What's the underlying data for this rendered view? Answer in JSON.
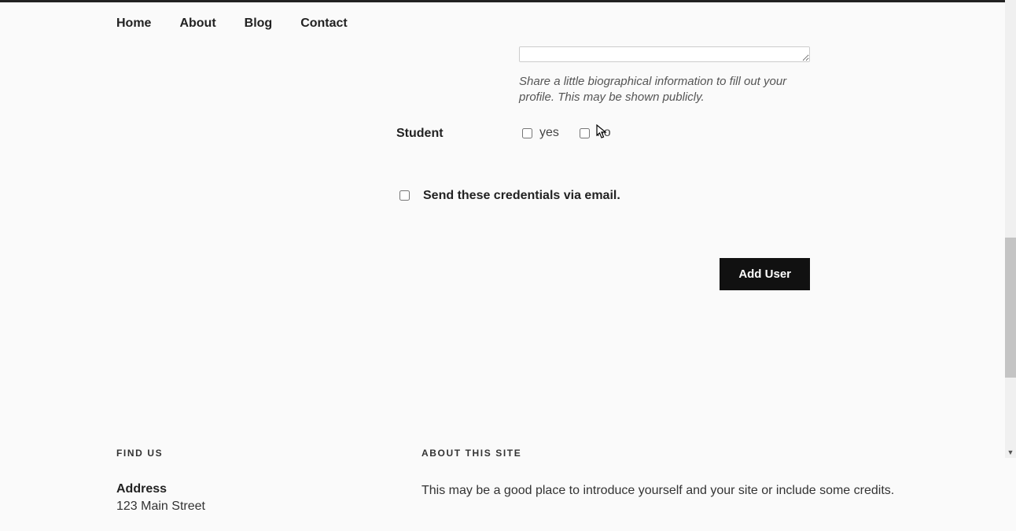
{
  "nav": {
    "items": [
      {
        "label": "Home"
      },
      {
        "label": "About"
      },
      {
        "label": "Blog"
      },
      {
        "label": "Contact"
      }
    ]
  },
  "form": {
    "bio_helper": "Share a little biographical information to fill out your profile. This may be shown publicly.",
    "student_label": "Student",
    "student_yes": "yes",
    "student_no": "no",
    "send_label": "Send these credentials via email.",
    "submit_label": "Add User"
  },
  "footer": {
    "find_us_heading": "FIND US",
    "address_label": "Address",
    "address_line1": "123 Main Street",
    "about_heading": "ABOUT THIS SITE",
    "about_text": "This may be a good place to introduce yourself and your site or include some credits."
  }
}
